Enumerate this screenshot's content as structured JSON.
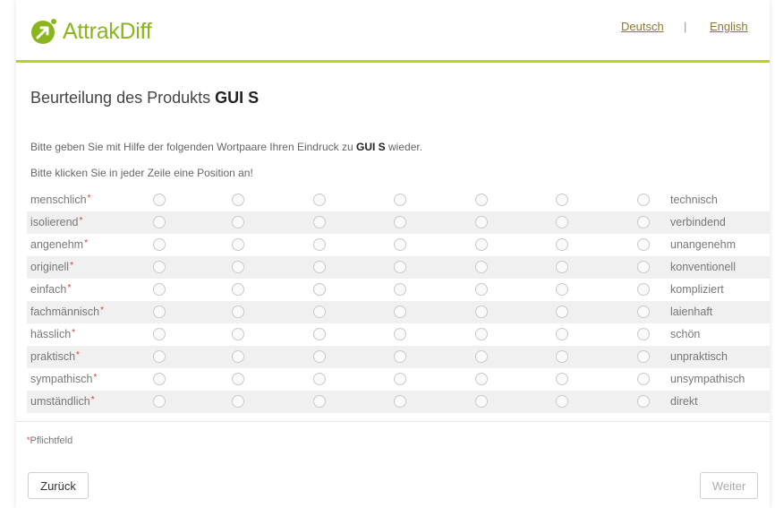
{
  "header": {
    "logo_text": "AttrakDiff",
    "lang_de": "Deutsch",
    "lang_separator": "|",
    "lang_en": "English"
  },
  "title": {
    "prefix": "Beurteilung des Produkts",
    "product": "GUI S"
  },
  "intro": {
    "before": "Bitte geben Sie mit Hilfe der folgenden Wortpaare Ihren Eindruck zu",
    "product": "GUI S",
    "after": "wieder."
  },
  "instruction": "Bitte klicken Sie in jeder Zeile eine Position an!",
  "required_marker": "*",
  "rows": [
    {
      "left": "menschlich",
      "right": "technisch"
    },
    {
      "left": "isolierend",
      "right": "verbindend"
    },
    {
      "left": "angenehm",
      "right": "unangenehm"
    },
    {
      "left": "originell",
      "right": "konventionell"
    },
    {
      "left": "einfach",
      "right": "kompliziert"
    },
    {
      "left": "fachmännisch",
      "right": "laienhaft"
    },
    {
      "left": "hässlich",
      "right": "schön"
    },
    {
      "left": "praktisch",
      "right": "unpraktisch"
    },
    {
      "left": "sympathisch",
      "right": "unsympathisch"
    },
    {
      "left": "umständlich",
      "right": "direkt"
    }
  ],
  "footer": {
    "required_note": "Pflichtfeld",
    "back_label": "Zurück",
    "next_label": "Weiter"
  },
  "colors": {
    "brand_green": "#8ab51d",
    "header_rule": "#b9cf2a",
    "required_red": "#e5322d"
  }
}
